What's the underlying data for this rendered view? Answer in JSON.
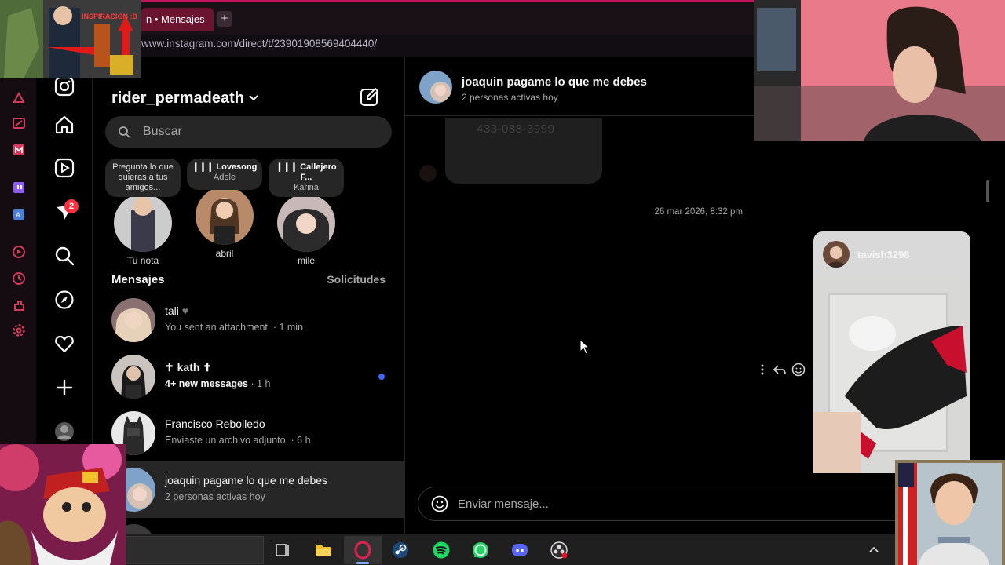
{
  "browser": {
    "tab_title": "n • Mensajes",
    "new_tab_symbol": "+",
    "url": "www.instagram.com/direct/t/23901908569404440/"
  },
  "overlay": {
    "thumbnail_caption": "INSPIRACIÓN :D"
  },
  "nav": {
    "notifications_badge": "2"
  },
  "inbox": {
    "username": "rider_permadeath",
    "search_placeholder": "Buscar",
    "notes": [
      {
        "bubble": "Pregunta lo que quieras a tus amigos...",
        "name": "Tu nota"
      },
      {
        "song": "Lovesong",
        "artist": "Adele",
        "name": "abril"
      },
      {
        "song": "Callejero F...",
        "artist": "Karina",
        "name": "mile"
      }
    ],
    "messages_heading": "Mensajes",
    "requests_label": "Solicitudes",
    "threads": [
      {
        "name": "tali",
        "preview": "You sent an attachment. · 1 min",
        "bold": false,
        "unread": false
      },
      {
        "name": "✝ kath ✝",
        "preview_bold": "4+ new messages",
        "preview_rest": " · 1 h",
        "bold": true,
        "unread": true
      },
      {
        "name": "Francisco Rebolledo",
        "preview": "Enviaste un archivo adjunto. · 6 h",
        "bold": false,
        "unread": false
      },
      {
        "name": "joaquin pagame lo que me debes",
        "preview": "2 personas activas hoy",
        "bold": false,
        "active": true
      }
    ]
  },
  "chat": {
    "title": "joaquin pagame lo que me debes",
    "status": "2 personas activas hoy",
    "shared_card_text": "433-088-3999",
    "timestamp": "26 mar 2026, 8:32 pm",
    "reel_user": "tavish3298",
    "composer_placeholder": "Enviar mensaje..."
  },
  "colors": {
    "accent_blue": "#3f63ff",
    "badge_red": "#ff3040",
    "tab_active": "#6a1430"
  }
}
